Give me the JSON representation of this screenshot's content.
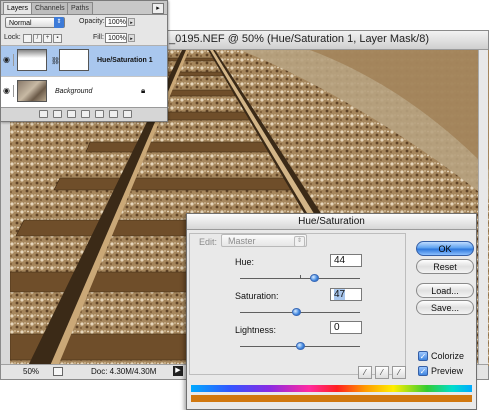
{
  "document": {
    "title": "_0195.NEF @ 50% (Hue/Saturation 1, Layer Mask/8)",
    "status_zoom": "50%",
    "status_doc": "Doc: 4.30M/4.30M"
  },
  "layers_palette": {
    "tabs": [
      "Layers",
      "Channels",
      "Paths"
    ],
    "active_tab": "Layers",
    "blend_mode": "Normal",
    "opacity_label": "Opacity:",
    "opacity_value": "100%",
    "lock_label": "Lock:",
    "fill_label": "Fill:",
    "fill_value": "100%",
    "layers": [
      {
        "name": "Hue/Saturation 1",
        "selected": true
      },
      {
        "name": "Background",
        "selected": false
      }
    ]
  },
  "hue_saturation": {
    "title": "Hue/Saturation",
    "edit_label": "Edit:",
    "edit_value": "Master",
    "hue_label": "Hue:",
    "hue_value": "44",
    "hue_level": 0.62,
    "saturation_label": "Saturation:",
    "saturation_value": "47",
    "saturation_level": 0.47,
    "lightness_label": "Lightness:",
    "lightness_value": "0",
    "lightness_level": 0.5,
    "buttons": {
      "ok": "OK",
      "reset": "Reset",
      "load": "Load...",
      "save": "Save..."
    },
    "colorize_label": "Colorize",
    "colorize_checked": true,
    "preview_label": "Preview",
    "preview_checked": true,
    "colorize_color": "#d1780f"
  }
}
